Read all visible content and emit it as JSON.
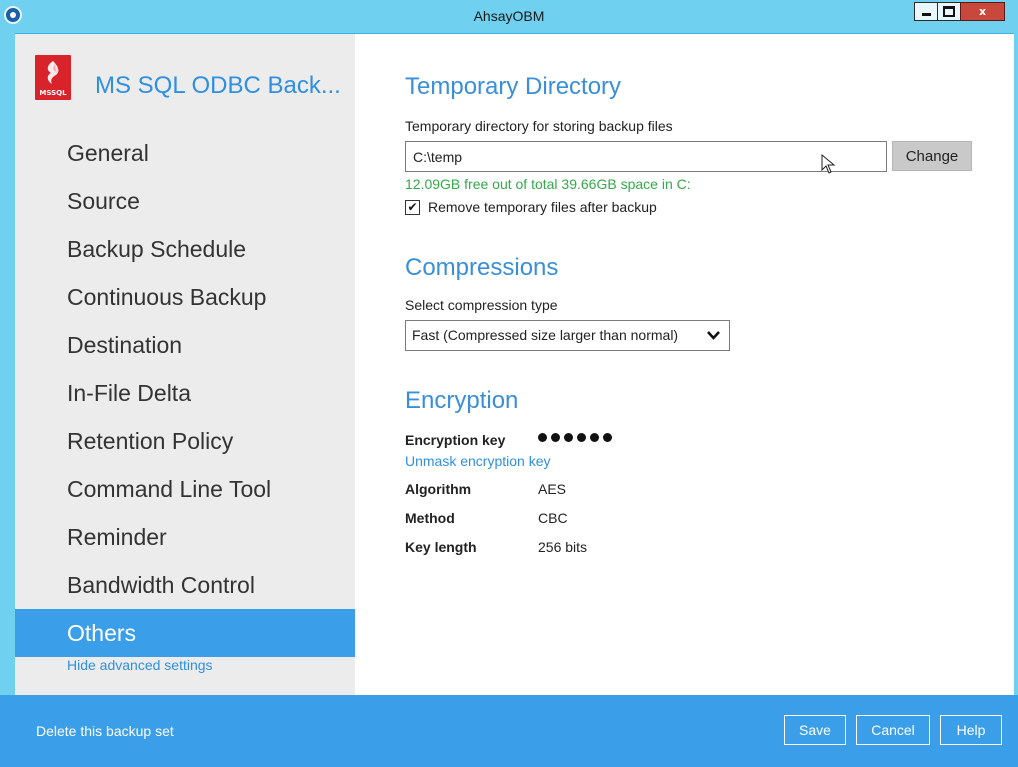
{
  "window": {
    "title": "AhsayOBM",
    "close_glyph": "x"
  },
  "sidebar": {
    "logo_caption": "MSSQL",
    "backup_set_name": "MS SQL ODBC Back...",
    "items": [
      {
        "label": "General"
      },
      {
        "label": "Source"
      },
      {
        "label": "Backup Schedule"
      },
      {
        "label": "Continuous Backup"
      },
      {
        "label": "Destination"
      },
      {
        "label": "In-File Delta"
      },
      {
        "label": "Retention Policy"
      },
      {
        "label": "Command Line Tool"
      },
      {
        "label": "Reminder"
      },
      {
        "label": "Bandwidth Control"
      },
      {
        "label": "Others"
      }
    ],
    "hide_advanced_label": "Hide advanced settings"
  },
  "temporary_directory": {
    "title": "Temporary Directory",
    "field_label": "Temporary directory for storing backup files",
    "path_value": "C:\\temp",
    "change_label": "Change",
    "free_space_text": "12.09GB free out of total 39.66GB space in C:",
    "remove_temp_label": "Remove temporary files after backup",
    "remove_temp_checked": true,
    "check_glyph": "✔"
  },
  "compressions": {
    "title": "Compressions",
    "field_label": "Select compression type",
    "selected": "Fast (Compressed size larger than normal)"
  },
  "encryption": {
    "title": "Encryption",
    "key_label": "Encryption key",
    "unmask_label": "Unmask encryption key",
    "algorithm_label": "Algorithm",
    "algorithm_value": "AES",
    "method_label": "Method",
    "method_value": "CBC",
    "key_length_label": "Key length",
    "key_length_value": "256 bits"
  },
  "footer": {
    "delete_label": "Delete this backup set",
    "save_label": "Save",
    "cancel_label": "Cancel",
    "help_label": "Help"
  },
  "colors": {
    "accent": "#3b9ee8",
    "title_bar": "#6fd0f0",
    "link": "#2f8fe0",
    "success": "#35a84b",
    "close": "#c9483c"
  }
}
